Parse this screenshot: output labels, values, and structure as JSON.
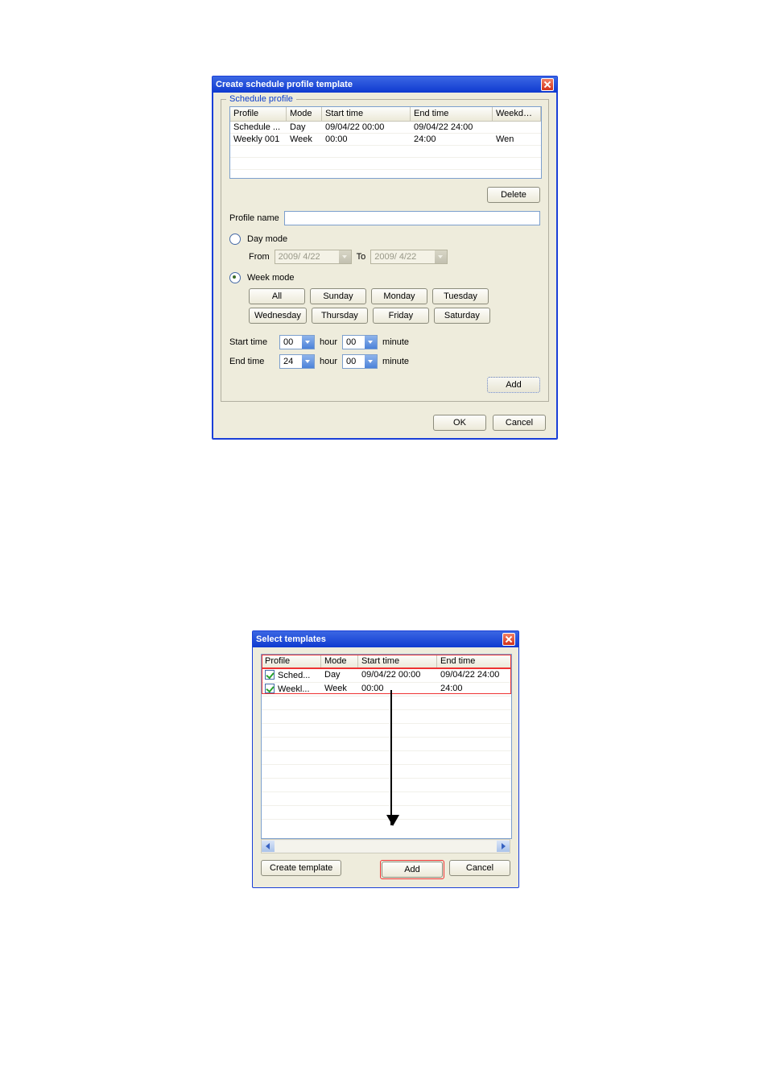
{
  "win1": {
    "title": "Create schedule profile template",
    "group_title": "Schedule profile",
    "columns": {
      "profile": "Profile",
      "mode": "Mode",
      "start": "Start time",
      "end": "End time",
      "weekdays": "Weekdays"
    },
    "rows": [
      {
        "profile": "Schedule ...",
        "mode": "Day",
        "start": "09/04/22 00:00",
        "end": "09/04/22 24:00",
        "weekdays": ""
      },
      {
        "profile": "Weekly 001",
        "mode": "Week",
        "start": "00:00",
        "end": "24:00",
        "weekdays": "Wen"
      }
    ],
    "labels": {
      "profile_name": "Profile name",
      "day_mode": "Day mode",
      "from": "From",
      "to": "To",
      "week_mode": "Week mode",
      "start_time": "Start time",
      "end_time": "End time",
      "hour": "hour",
      "minute": "minute"
    },
    "weekdays": [
      "All",
      "Sunday",
      "Monday",
      "Tuesday",
      "Wednesday",
      "Thursday",
      "Friday",
      "Saturday"
    ],
    "inputs": {
      "profile_name": "",
      "from_date": "2009/ 4/22",
      "to_date": "2009/ 4/22",
      "start_hour": "00",
      "start_min": "00",
      "end_hour": "24",
      "end_min": "00"
    },
    "buttons": {
      "delete": "Delete",
      "add": "Add",
      "ok": "OK",
      "cancel": "Cancel"
    },
    "mode_selected": "week"
  },
  "win2": {
    "title": "Select templates",
    "columns": {
      "profile": "Profile",
      "mode": "Mode",
      "start": "Start time",
      "end": "End time"
    },
    "rows": [
      {
        "checked": true,
        "profile": "Sched...",
        "mode": "Day",
        "start": "09/04/22 00:00",
        "end": "09/04/22 24:00"
      },
      {
        "checked": true,
        "profile": "Weekl...",
        "mode": "Week",
        "start": "00:00",
        "end": "24:00"
      }
    ],
    "buttons": {
      "create": "Create template",
      "add": "Add",
      "cancel": "Cancel"
    }
  }
}
